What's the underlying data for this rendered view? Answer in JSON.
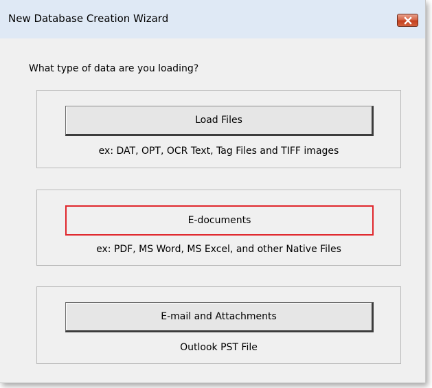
{
  "window": {
    "title": "New Database Creation Wizard",
    "close_icon": "close-icon"
  },
  "prompt": "What type of data are you loading?",
  "options": [
    {
      "button_label": "Load Files",
      "description": "ex: DAT, OPT, OCR Text, Tag Files and TIFF images"
    },
    {
      "button_label": "E-documents",
      "description": "ex: PDF, MS Word, MS Excel, and other Native Files",
      "highlighted": true,
      "highlight_color": "#e0262b"
    },
    {
      "button_label": "E-mail and Attachments",
      "description": "Outlook PST File"
    }
  ]
}
